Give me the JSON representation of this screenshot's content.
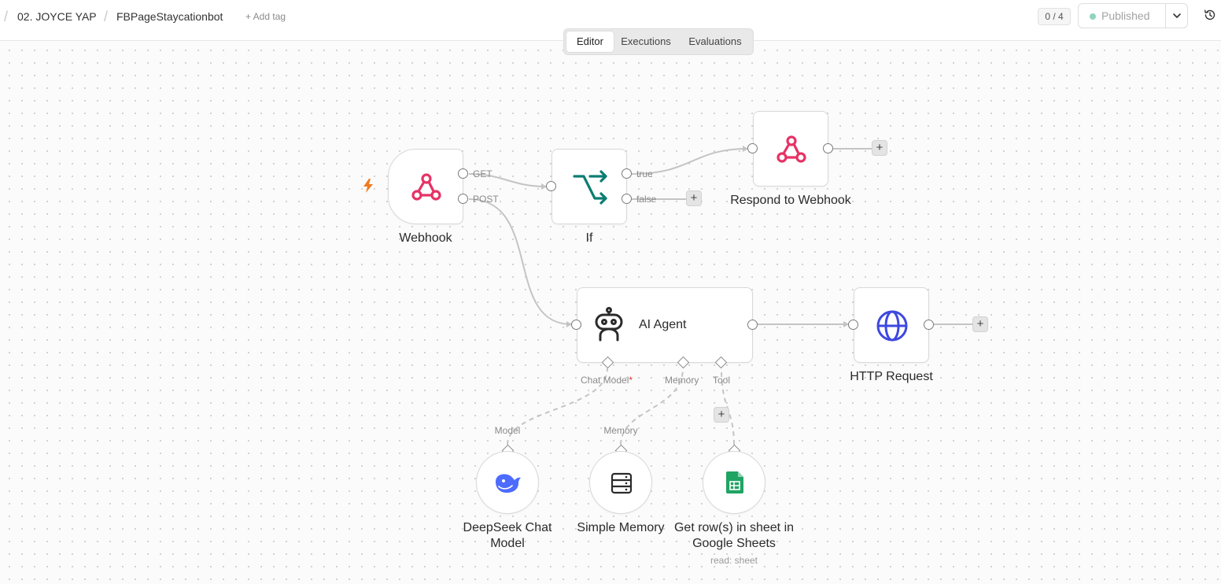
{
  "breadcrumb": {
    "project": "02. JOYCE YAP",
    "workflow": "FBPageStaycationbot",
    "add_tag": "+ Add tag"
  },
  "header": {
    "counter": "0 / 4",
    "publish_label": "Published"
  },
  "tabs": [
    "Editor",
    "Executions",
    "Evaluations"
  ],
  "nodes": {
    "webhook": {
      "label": "Webhook",
      "out_get": "GET",
      "out_post": "POST"
    },
    "if": {
      "label": "If",
      "out_true": "true",
      "out_false": "false"
    },
    "respond": {
      "label": "Respond to Webhook"
    },
    "agent": {
      "label": "AI Agent",
      "port_chat_model": "Chat Model",
      "port_required": "*",
      "port_memory": "Memory",
      "port_tool": "Tool"
    },
    "http": {
      "label": "HTTP Request"
    },
    "deepseek": {
      "label": "DeepSeek Chat Model",
      "port": "Model"
    },
    "memory": {
      "label": "Simple Memory",
      "port": "Memory"
    },
    "sheets": {
      "label": "Get row(s) in sheet in Google Sheets",
      "sub": "read: sheet"
    }
  },
  "plus": "+",
  "colors": {
    "webhook": "#e63365",
    "if": "#0d7d72",
    "http": "#3e48e0",
    "deepseek": "#4d6bfe",
    "sheets": "#1fa463",
    "trigger": "#f07a1e",
    "published_dot": "#8fd4c0"
  }
}
